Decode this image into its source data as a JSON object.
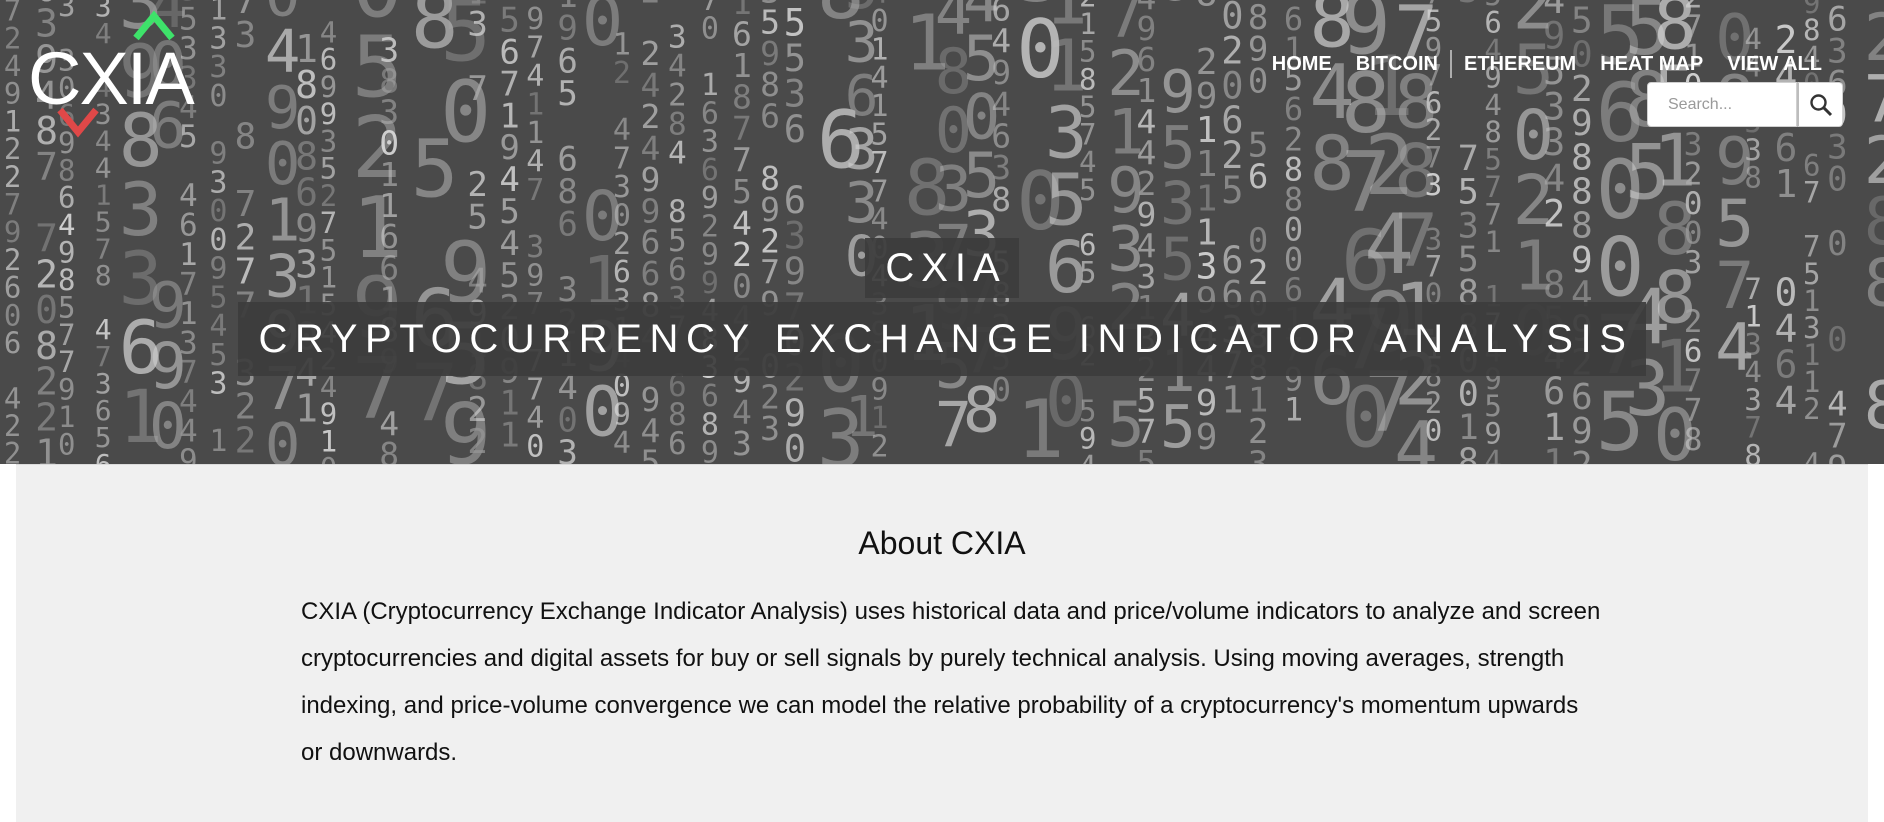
{
  "header": {
    "logo_text": "CXIA",
    "nav": [
      {
        "label": "HOME"
      },
      {
        "label": "BITCOIN"
      },
      {
        "label": "ETHEREUM"
      },
      {
        "label": "HEAT MAP"
      },
      {
        "label": "VIEW ALL"
      }
    ],
    "search": {
      "placeholder": "Search...",
      "icon": "search-icon"
    }
  },
  "hero": {
    "brand": "CXIA",
    "tagline": "CRYPTOCURRENCY EXCHANGE INDICATOR ANALYSIS",
    "background": "numbers-matrix"
  },
  "about": {
    "heading": "About CXIA",
    "body": "CXIA (Cryptocurrency Exchange Indicator Analysis) uses historical data and price/volume indicators to analyze and screen cryptocurrencies and digital assets for buy or sell signals by purely technical analysis. Using moving averages, strength indexing, and price-volume convergence we can model the relative probability of a cryptocurrency's momentum upwards or downwards."
  },
  "colors": {
    "hero_bg": "#4a4a4a",
    "accent_up": "#3ee26a",
    "accent_down": "#e04848",
    "about_bg": "#f0f0f0"
  }
}
